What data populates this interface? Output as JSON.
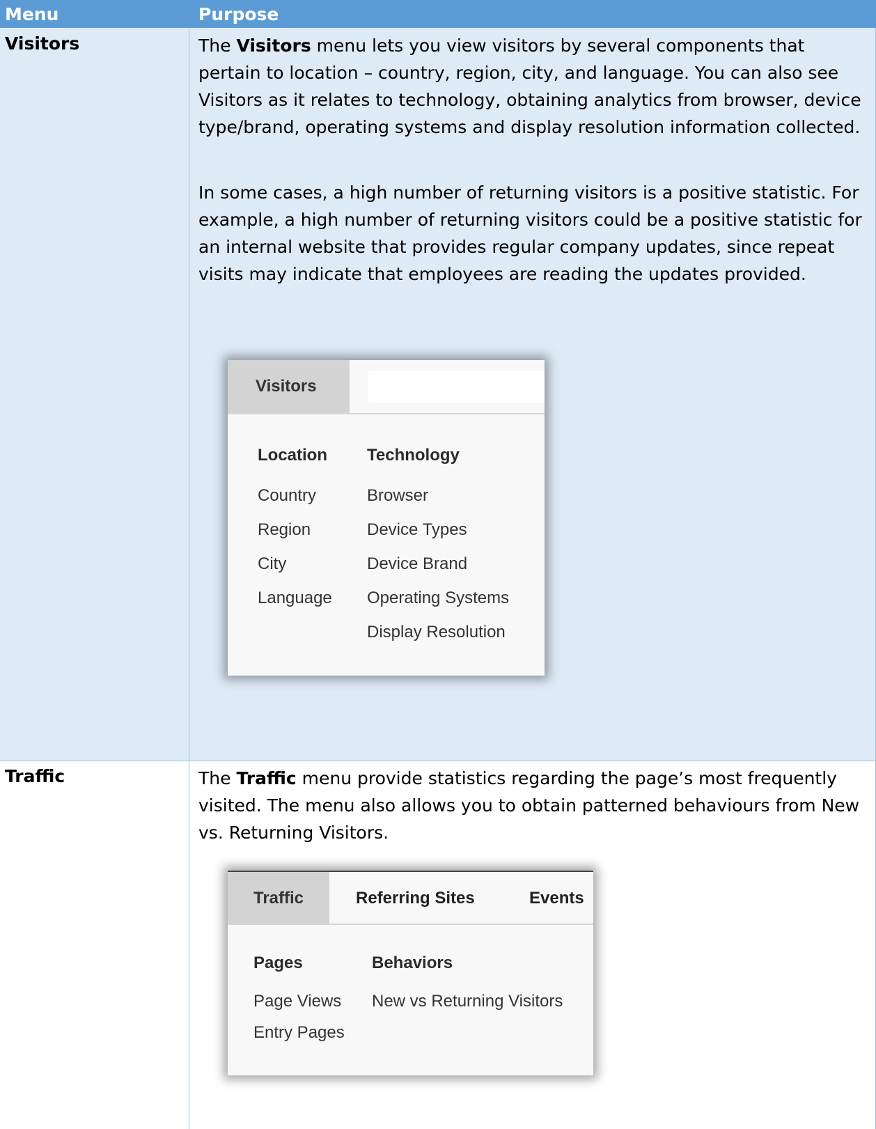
{
  "table": {
    "headers": {
      "menu": "Menu",
      "purpose": "Purpose"
    },
    "rows": [
      {
        "menu": "Visitors",
        "paragraphs": [
          {
            "parts": [
              {
                "t": "The ",
                "b": false
              },
              {
                "t": "Visitors",
                "b": true
              },
              {
                "t": " menu lets you view visitors by several components that pertain to location – country, region, city, and language. You can also see Visitors as it relates to technology, obtaining analytics from browser, device type/brand, operating systems and display resolution information collected.",
                "b": false
              }
            ]
          },
          {
            "parts": [
              {
                "t": "In some cases, a high number of returning visitors is a positive statistic. For example, a high number of returning visitors could be a positive statistic for an internal website that provides regular company updates, since repeat visits may indicate that employees are reading the updates provided.",
                "b": false
              }
            ]
          }
        ],
        "screenshot": {
          "active_tab": "Visitors",
          "columns": [
            {
              "heading": "Location",
              "items": [
                "Country",
                "Region",
                "City",
                "Language"
              ]
            },
            {
              "heading": "Technology",
              "items": [
                "Browser",
                "Device Types",
                "Device Brand",
                "Operating Systems",
                "Display Resolution"
              ]
            }
          ]
        }
      },
      {
        "menu": "Traffic",
        "paragraphs": [
          {
            "parts": [
              {
                "t": "The ",
                "b": false
              },
              {
                "t": "Traffic",
                "b": true
              },
              {
                "t": " menu provide statistics regarding the page’s most frequently visited. The menu also allows you to obtain patterned behaviours from New vs. Returning Visitors.",
                "b": false
              }
            ]
          }
        ],
        "screenshot": {
          "active_tab": "Traffic",
          "tabs": [
            "Referring Sites",
            "Events"
          ],
          "columns": [
            {
              "heading": "Pages",
              "items": [
                "Page Views",
                "Entry Pages"
              ]
            },
            {
              "heading": "Behaviors",
              "items": [
                "New vs Returning Visitors"
              ]
            }
          ]
        }
      }
    ]
  },
  "colors": {
    "header_bg": "#5b9bd5",
    "row_shade": "#deeaf6",
    "border": "#9cc2e5"
  }
}
